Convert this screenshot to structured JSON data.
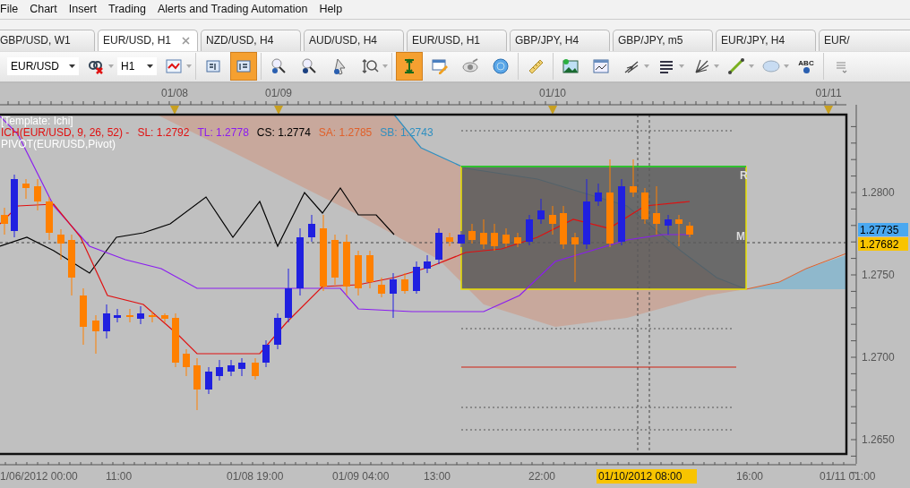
{
  "menu": [
    "File",
    "Chart",
    "Insert",
    "Trading",
    "Alerts and Trading Automation",
    "Help"
  ],
  "tabs": [
    {
      "label": "GBP/USD, W1",
      "selected": false
    },
    {
      "label": "EUR/USD, H1",
      "selected": true
    },
    {
      "label": "NZD/USD, H4",
      "selected": false
    },
    {
      "label": "AUD/USD, H4",
      "selected": false
    },
    {
      "label": "EUR/USD, H1",
      "selected": false
    },
    {
      "label": "GBP/JPY, H4",
      "selected": false
    },
    {
      "label": "GBP/JPY, m5",
      "selected": false
    },
    {
      "label": "EUR/JPY, H4",
      "selected": false
    },
    {
      "label": "EUR/",
      "selected": false
    }
  ],
  "toolbar": {
    "symbol": "EUR/USD",
    "period": "H1",
    "tools": [
      {
        "pressed": false,
        "menu": true
      },
      {
        "pressed": false,
        "menu": true
      },
      {
        "pressed": false,
        "menu": false
      },
      {
        "pressed": true,
        "menu": false
      },
      {
        "pressed": false,
        "menu": false
      },
      {
        "pressed": false,
        "menu": false
      },
      {
        "pressed": false,
        "menu": false
      },
      {
        "pressed": false,
        "menu": true
      },
      {
        "pressed": true,
        "menu": false
      },
      {
        "pressed": false,
        "menu": false
      },
      {
        "pressed": false,
        "menu": false
      },
      {
        "pressed": false,
        "menu": false
      },
      {
        "pressed": false,
        "menu": false
      },
      {
        "pressed": false,
        "menu": false
      },
      {
        "pressed": false,
        "menu": false
      },
      {
        "pressed": false,
        "menu": true
      },
      {
        "pressed": false,
        "menu": true
      },
      {
        "pressed": false,
        "menu": true
      },
      {
        "pressed": false,
        "menu": true
      },
      {
        "pressed": false,
        "menu": true
      },
      {
        "pressed": false,
        "menu": false,
        "label": "ABC"
      },
      {
        "pressed": false,
        "menu": false
      }
    ]
  },
  "chart": {
    "template": "[Template: Ichi]",
    "indicator": "ICH(EUR/USD, 9, 26, 52) -",
    "lines": [
      {
        "label": "SL: 1.2792",
        "color": "#e01010"
      },
      {
        "label": "TL: 1.2778",
        "color": "#8a1cf0"
      },
      {
        "label": "CS: 1.2774",
        "color": "#000000"
      },
      {
        "label": "SA: 1.2785",
        "color": "#e0602a"
      },
      {
        "label": "SB: 1.2743",
        "color": "#2f8fc0"
      }
    ],
    "pivot": "PIVOT(EUR/USD,Pivot)",
    "top_dates": [
      "01/08",
      "01/09",
      "01/10",
      "01/11"
    ],
    "zone_labels": [
      "R",
      "M"
    ],
    "price_ticks": [
      "1.2800",
      "1.2750",
      "1.2700",
      "1.2650"
    ],
    "price_labels": [
      {
        "text": "1.27735",
        "color": "#4aa8f0"
      },
      {
        "text": "1.27682",
        "color": "#f8c400"
      }
    ],
    "time_labels": [
      {
        "text": "1/06/2012 00:00",
        "highlighted": false
      },
      {
        "text": "11:00",
        "highlighted": false
      },
      {
        "text": "01/08 19:00",
        "highlighted": false
      },
      {
        "text": "01/09 04:00",
        "highlighted": false
      },
      {
        "text": "13:00",
        "highlighted": false
      },
      {
        "text": "22:00",
        "highlighted": false
      },
      {
        "text": "01/10/2012 08:00",
        "highlighted": true
      },
      {
        "text": "16:00",
        "highlighted": false
      },
      {
        "text": "01/11 01:00",
        "highlighted": false
      }
    ]
  }
}
